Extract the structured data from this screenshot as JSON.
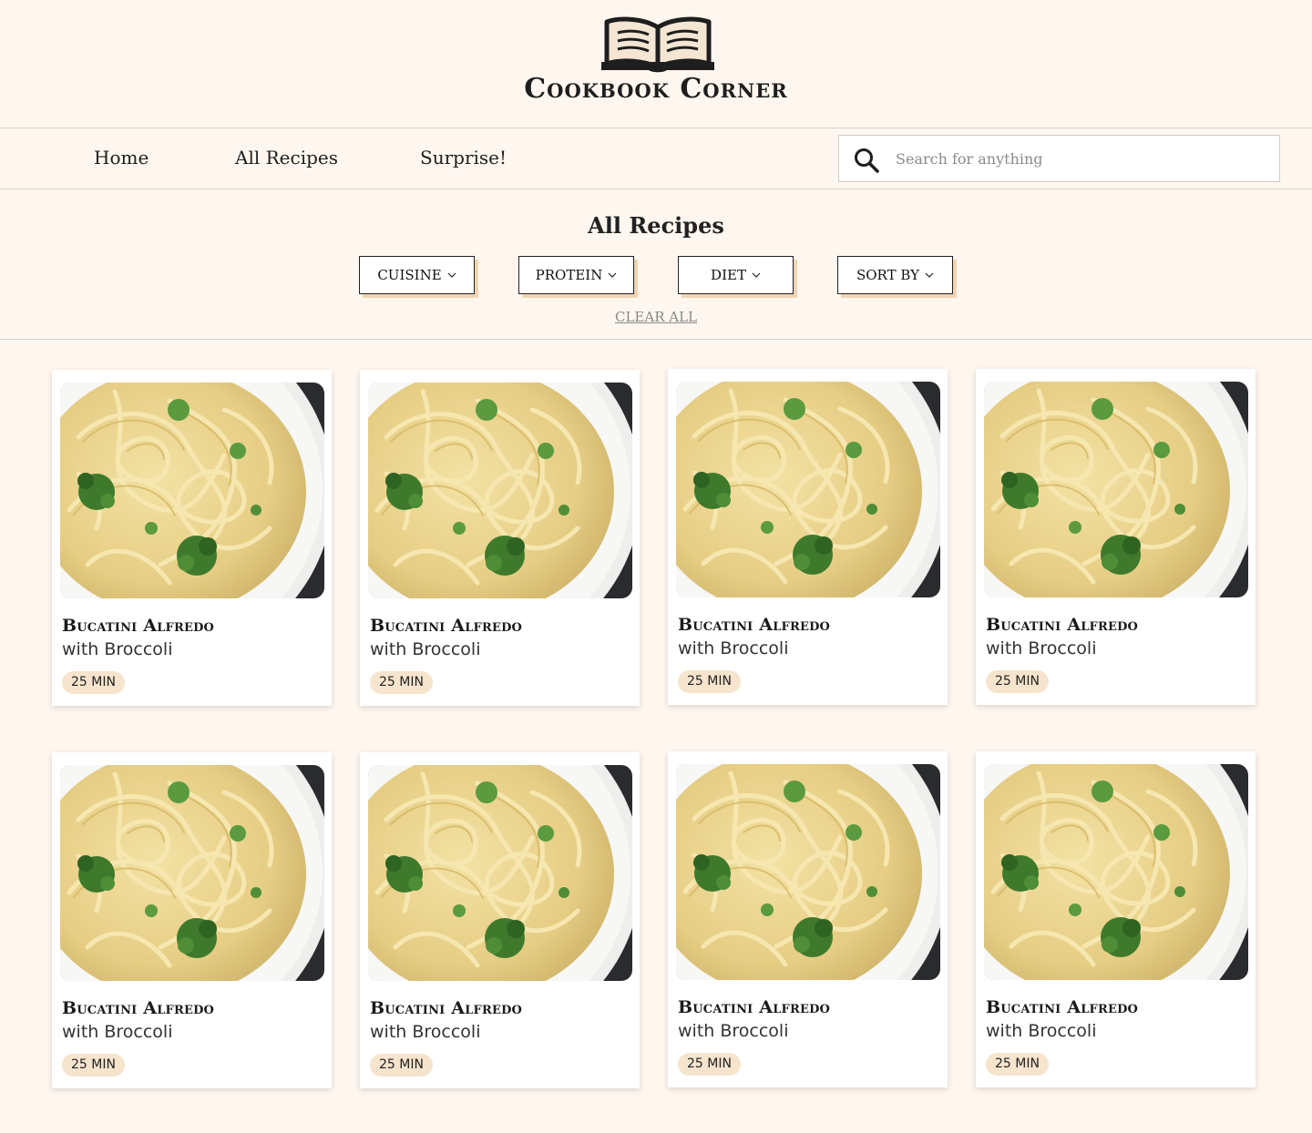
{
  "brand": {
    "name": "Cookbook Corner",
    "logo_icon": "open-book-icon"
  },
  "nav": {
    "links": [
      "Home",
      "All Recipes",
      "Surprise!"
    ]
  },
  "search": {
    "placeholder": "Search for anything",
    "value": "",
    "icon": "search-icon"
  },
  "page": {
    "title": "All Recipes"
  },
  "filters": {
    "buttons": [
      "CUISINE",
      "PROTEIN",
      "DIET",
      "SORT BY"
    ],
    "clear_label": "CLEAR ALL"
  },
  "recipes": [
    {
      "title": "Bucatini Alfredo",
      "subtitle": "with Broccoli",
      "time": "25 MIN"
    },
    {
      "title": "Bucatini Alfredo",
      "subtitle": "with Broccoli",
      "time": "25 MIN"
    },
    {
      "title": "Bucatini Alfredo",
      "subtitle": "with Broccoli",
      "time": "25 MIN"
    },
    {
      "title": "Bucatini Alfredo",
      "subtitle": "with Broccoli",
      "time": "25 MIN"
    },
    {
      "title": "Bucatini Alfredo",
      "subtitle": "with Broccoli",
      "time": "25 MIN"
    },
    {
      "title": "Bucatini Alfredo",
      "subtitle": "with Broccoli",
      "time": "25 MIN"
    },
    {
      "title": "Bucatini Alfredo",
      "subtitle": "with Broccoli",
      "time": "25 MIN"
    },
    {
      "title": "Bucatini Alfredo",
      "subtitle": "with Broccoli",
      "time": "25 MIN"
    }
  ],
  "colors": {
    "background": "#fff7ef",
    "button_shadow": "#f0d5b2",
    "badge": "#f6e4cd"
  }
}
